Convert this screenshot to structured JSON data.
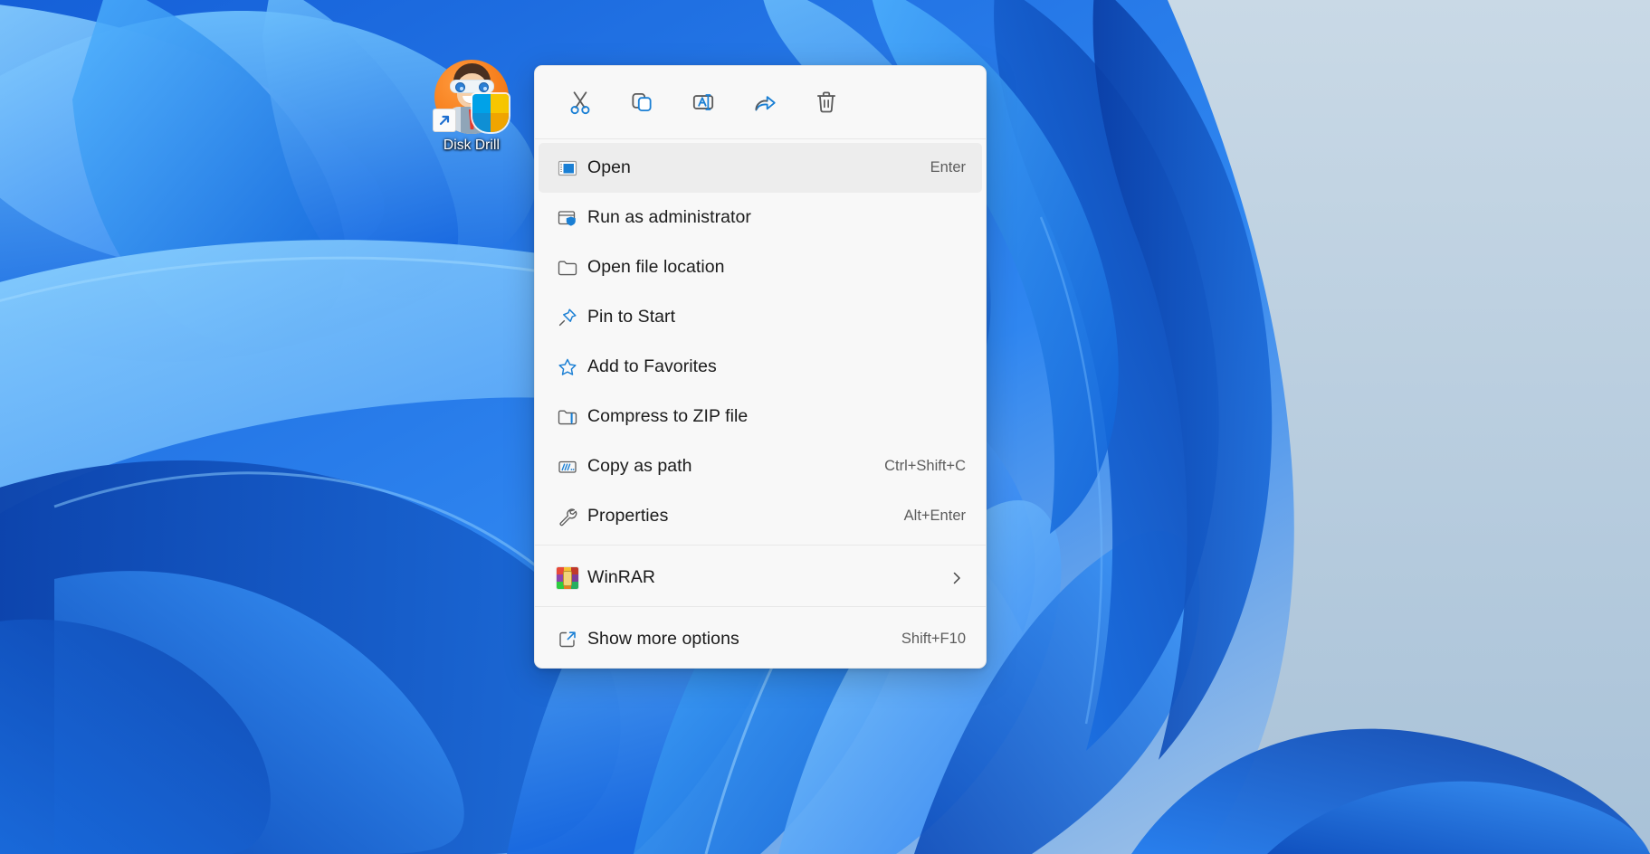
{
  "desktop": {
    "icon": {
      "label": "Disk Drill",
      "art_name": "disk-drill-app-icon",
      "shortcut_badge": "shortcut-arrow-badge"
    },
    "wallpaper_name": "windows-11-bloom-wallpaper",
    "background_color": "#b9cde0"
  },
  "context_menu": {
    "command_bar": [
      {
        "name": "cut-button",
        "icon": "scissors-icon",
        "tooltip": "Cut"
      },
      {
        "name": "copy-button",
        "icon": "copy-icon",
        "tooltip": "Copy"
      },
      {
        "name": "rename-button",
        "icon": "rename-icon",
        "tooltip": "Rename"
      },
      {
        "name": "share-button",
        "icon": "share-icon",
        "tooltip": "Share"
      },
      {
        "name": "delete-button",
        "icon": "trash-icon",
        "tooltip": "Delete"
      }
    ],
    "groups": [
      {
        "items": [
          {
            "label": "Open",
            "accel": "Enter",
            "icon": "open-window-icon",
            "selected": true,
            "submenu": false
          },
          {
            "label": "Run as administrator",
            "accel": "",
            "icon": "shield-window-icon",
            "selected": false,
            "submenu": false
          },
          {
            "label": "Open file location",
            "accel": "",
            "icon": "folder-icon",
            "selected": false,
            "submenu": false
          },
          {
            "label": "Pin to Start",
            "accel": "",
            "icon": "pin-icon",
            "selected": false,
            "submenu": false
          },
          {
            "label": "Add to Favorites",
            "accel": "",
            "icon": "star-icon",
            "selected": false,
            "submenu": false
          },
          {
            "label": "Compress to ZIP file",
            "accel": "",
            "icon": "zip-folder-icon",
            "selected": false,
            "submenu": false
          },
          {
            "label": "Copy as path",
            "accel": "Ctrl+Shift+C",
            "icon": "copy-path-icon",
            "selected": false,
            "submenu": false
          },
          {
            "label": "Properties",
            "accel": "Alt+Enter",
            "icon": "wrench-icon",
            "selected": false,
            "submenu": false
          }
        ]
      },
      {
        "items": [
          {
            "label": "WinRAR",
            "accel": "",
            "icon": "winrar-icon",
            "selected": false,
            "submenu": true
          }
        ]
      },
      {
        "items": [
          {
            "label": "Show more options",
            "accel": "Shift+F10",
            "icon": "show-more-options-icon",
            "selected": false,
            "submenu": false
          }
        ]
      }
    ],
    "colors": {
      "surface": "#f8f8f8",
      "selected_row": "#ededed",
      "accent": "#0f6cbd",
      "icon_stroke": "#5b5b5b",
      "text": "#1b1b1b",
      "accel_text": "#5d5d5d",
      "separator": "#e8e8e8"
    }
  }
}
